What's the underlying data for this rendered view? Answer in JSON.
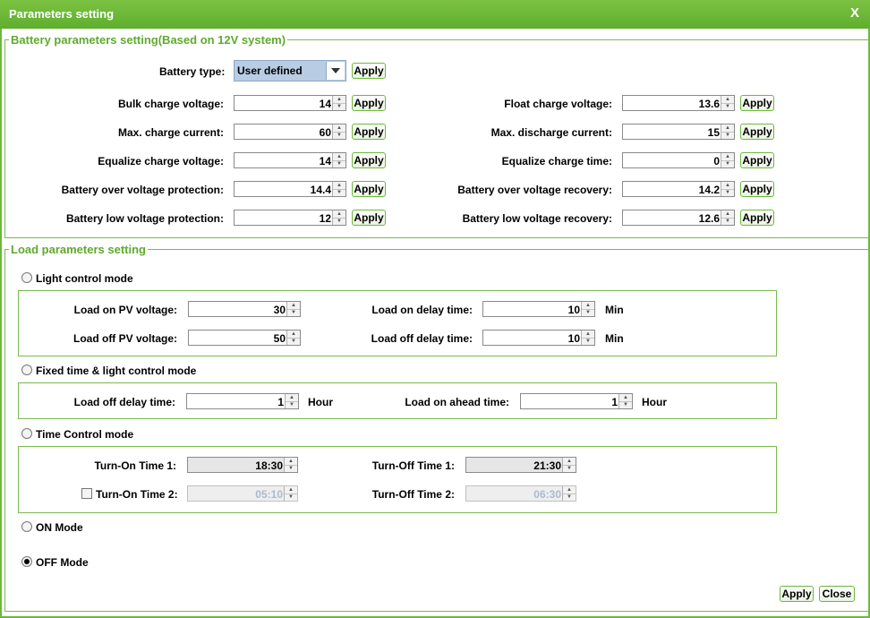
{
  "window": {
    "title": "Parameters setting",
    "close_symbol": "X"
  },
  "battery": {
    "legend": "Battery parameters setting(Based on 12V system)",
    "type_label": "Battery type:",
    "type_value": "User defined",
    "apply": "Apply",
    "bulk_label": "Bulk charge voltage:",
    "bulk_value": "14",
    "maxcharge_label": "Max. charge current:",
    "maxcharge_value": "60",
    "eqv_label": "Equalize charge voltage:",
    "eqv_value": "14",
    "ovp_label": "Battery over voltage protection:",
    "ovp_value": "14.4",
    "lvp_label": "Battery low voltage protection:",
    "lvp_value": "12",
    "float_label": "Float charge voltage:",
    "float_value": "13.6",
    "maxdis_label": "Max. discharge current:",
    "maxdis_value": "15",
    "eqt_label": "Equalize charge time:",
    "eqt_value": "0",
    "ovr_label": "Battery over voltage recovery:",
    "ovr_value": "14.2",
    "lvr_label": "Battery low voltage recovery:",
    "lvr_value": "12.6"
  },
  "load": {
    "legend": "Load parameters setting",
    "light_mode": "Light control mode",
    "on_pv_label": "Load on PV voltage:",
    "on_pv_value": "30",
    "off_pv_label": "Load off PV voltage:",
    "off_pv_value": "50",
    "on_delay_label": "Load on delay time:",
    "on_delay_value": "10",
    "off_delay_label": "Load off delay time:",
    "off_delay_value": "10",
    "min_unit": "Min",
    "fixed_mode": "Fixed time & light control mode",
    "fixed_off_delay_label": "Load off delay time:",
    "fixed_off_delay_value": "1",
    "ahead_label": "Load on ahead time:",
    "ahead_value": "1",
    "hour_unit": "Hour",
    "time_mode": "Time Control mode",
    "turn_on1_label": "Turn-On Time 1:",
    "turn_on1_value": "18:30",
    "turn_off1_label": "Turn-Off Time 1:",
    "turn_off1_value": "21:30",
    "turn_on2_label": "Turn-On Time 2:",
    "turn_on2_value": "05:10",
    "turn_off2_label": "Turn-Off Time 2:",
    "turn_off2_value": "06:30",
    "on_mode": "ON Mode",
    "off_mode": "OFF Mode",
    "selected_mode": "OFF Mode"
  },
  "footer": {
    "apply": "Apply",
    "close": "Close"
  },
  "colors": {
    "accent": "#6bb83a",
    "legend_text": "#5faa2f",
    "select_bg": "#b8cde4"
  },
  "icons": {
    "spinner_up": "▲",
    "spinner_down": "▼",
    "dropdown": "chevron-down-icon"
  }
}
